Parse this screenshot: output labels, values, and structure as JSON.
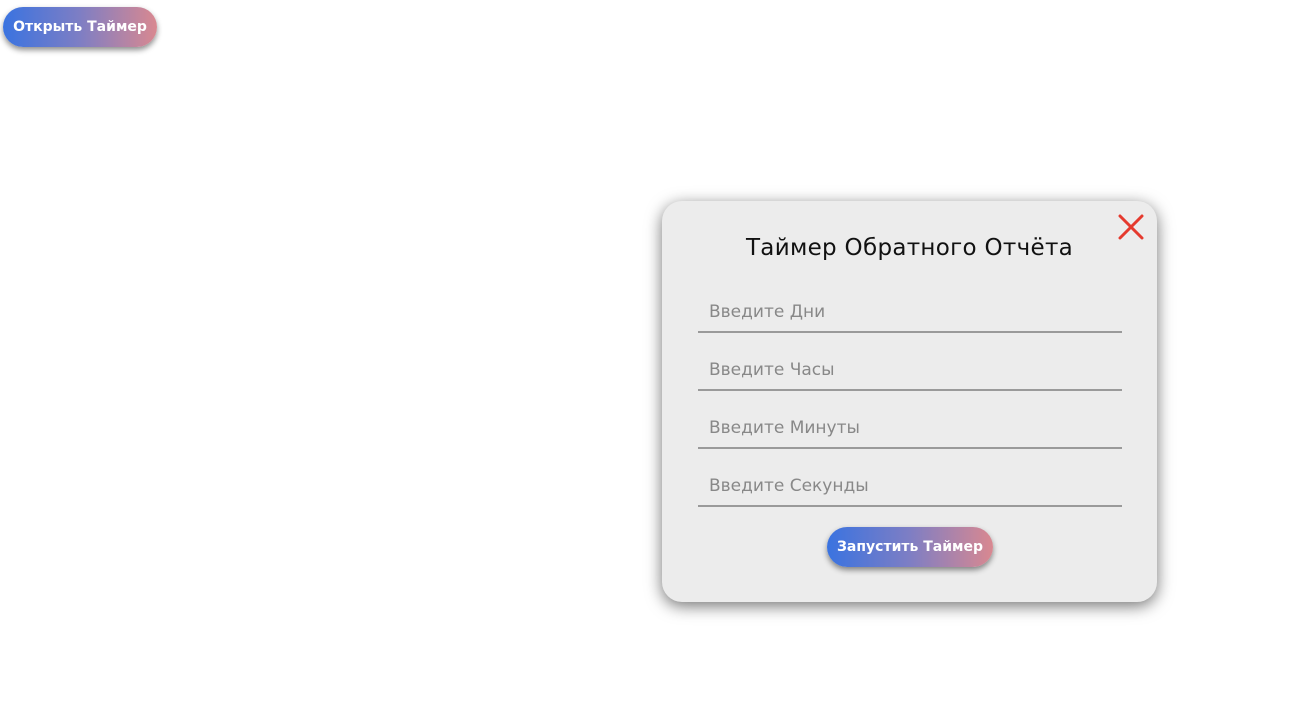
{
  "open_button": {
    "label": "Открыть Таймер"
  },
  "modal": {
    "title": "Таймер Обратного Отчёта",
    "close_icon": "close-icon",
    "close_color": "#e53a2e",
    "fields": {
      "days": {
        "placeholder": "Введите Дни",
        "value": ""
      },
      "hours": {
        "placeholder": "Введите Часы",
        "value": ""
      },
      "minutes": {
        "placeholder": "Введите Минуты",
        "value": ""
      },
      "seconds": {
        "placeholder": "Введите Секунды",
        "value": ""
      }
    },
    "start_button": {
      "label": "Запустить Таймер"
    }
  },
  "colors": {
    "gradient_start": "#3a73e0",
    "gradient_end": "#d98890",
    "modal_background": "#ececec"
  }
}
